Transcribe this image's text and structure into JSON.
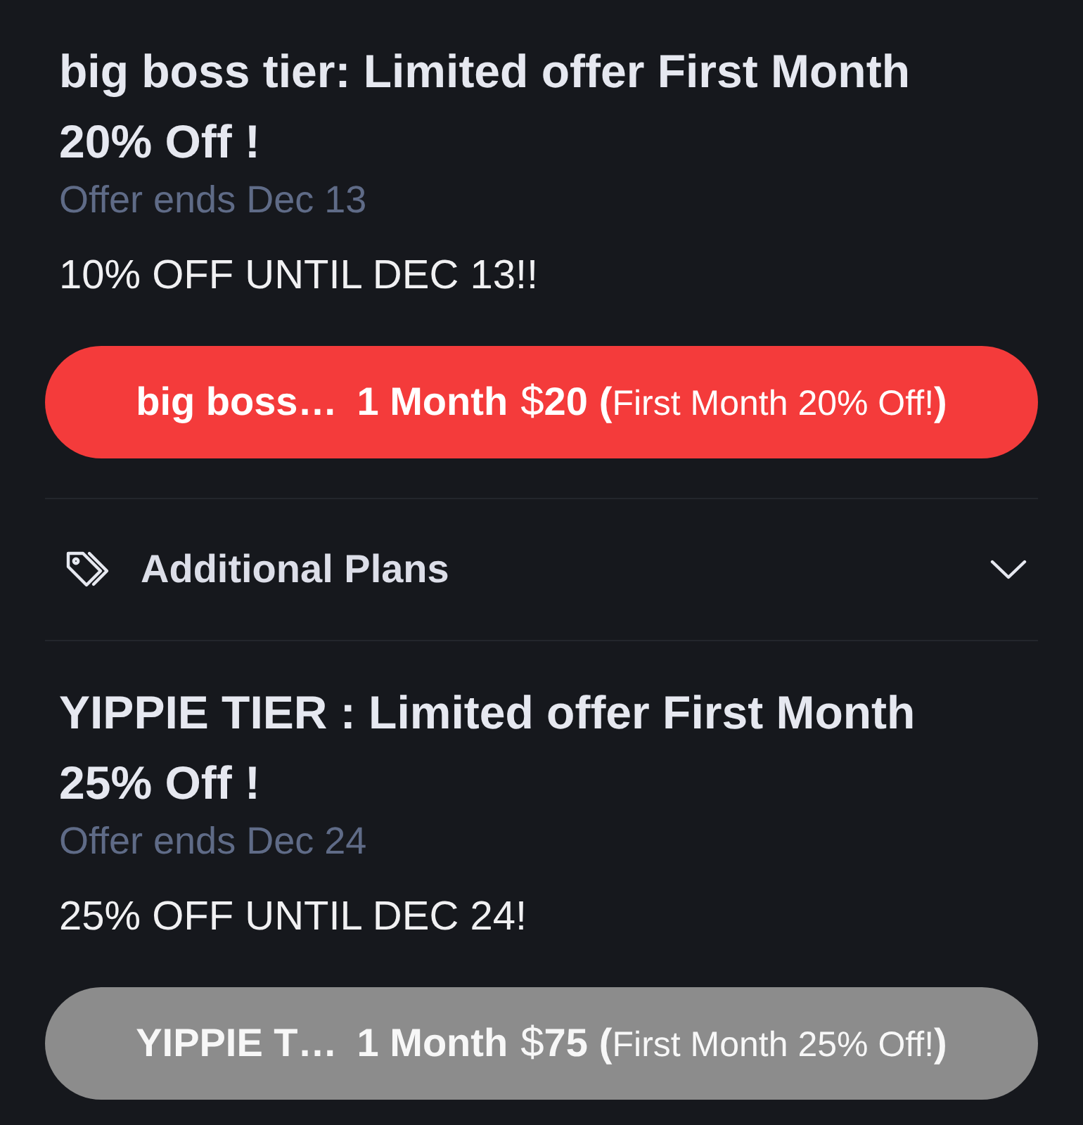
{
  "sections": [
    {
      "kind": "offer",
      "title": "big boss tier: Limited offer First Month 20% Off !",
      "ends": "Offer ends Dec 13",
      "description": "10% OFF UNTIL DEC 13!!",
      "button": {
        "tier": "big boss…",
        "term": "1 Month",
        "price": "$**20**",
        "note": "**(**First Month 20% Off!**)**",
        "disabled": false
      }
    },
    {
      "kind": "plans",
      "label": "Additional Plans",
      "expanded": false
    },
    {
      "kind": "offer",
      "title": "YIPPIE TIER : Limited offer First Month 25% Off !",
      "ends": "Offer ends Dec 24",
      "description": "25% OFF UNTIL DEC 24!",
      "button": {
        "tier": "YIPPIE T…",
        "term": "1 Month",
        "price": "$**75**",
        "note": "**(**First Month 25% Off!**)**",
        "disabled": true
      }
    }
  ]
}
